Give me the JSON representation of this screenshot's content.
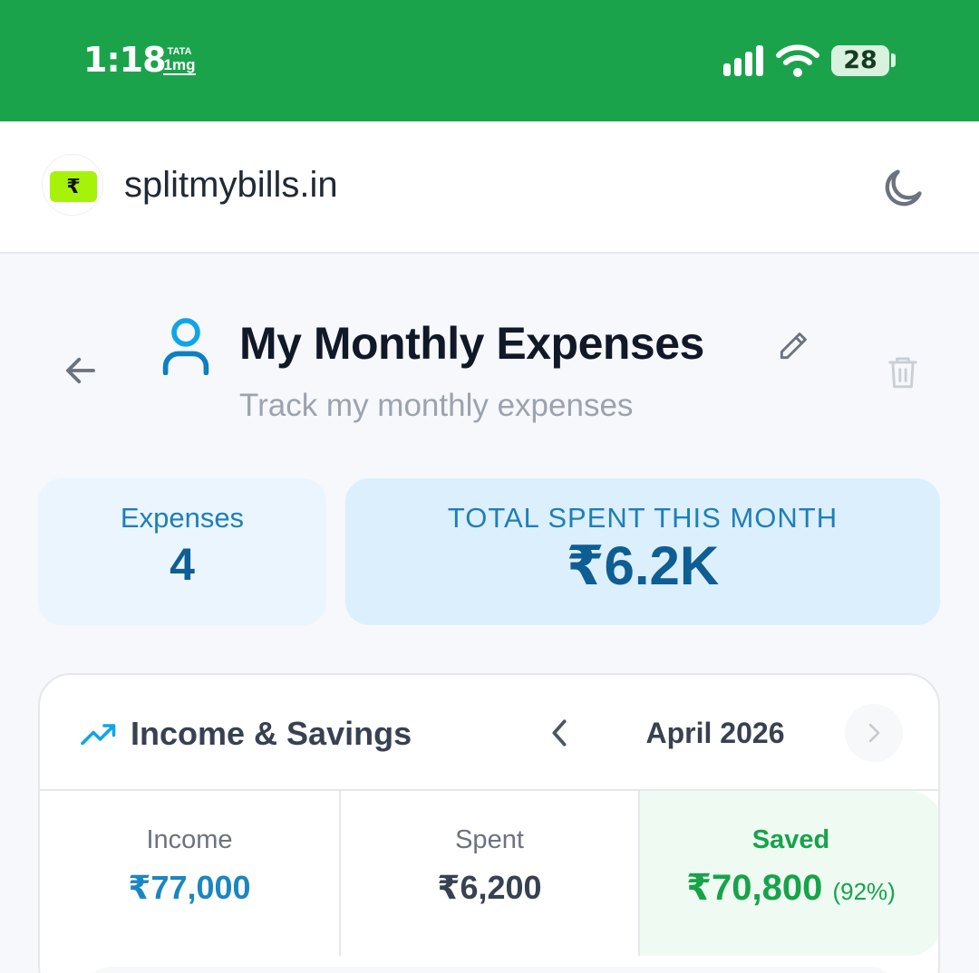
{
  "status_bar": {
    "time": "1:18",
    "notification": {
      "line1": "TATA",
      "line2": "1mg"
    },
    "battery": "28",
    "colors": {
      "background": "#1ba34c"
    }
  },
  "header": {
    "logo_symbol": "₹",
    "site_name": "splitmybills.in",
    "theme_toggle_icon": "moon-icon"
  },
  "page": {
    "title": "My Monthly Expenses",
    "subtitle": "Track my monthly expenses",
    "icons": [
      "back-arrow-icon",
      "user-icon",
      "pencil-icon",
      "trash-icon"
    ]
  },
  "stats": {
    "expenses_label": "Expenses",
    "expenses_count": "4",
    "total_label": "TOTAL SPENT THIS MONTH",
    "total_value": "₹6.2K"
  },
  "income": {
    "title": "Income & Savings",
    "month": "April 2026",
    "income_label": "Income",
    "income_value": "₹77,000",
    "spent_label": "Spent",
    "spent_value": "₹6,200",
    "saved_label": "Saved",
    "saved_value": "₹70,800",
    "saved_percent": "(92%)"
  },
  "colors": {
    "accent": "#0e5e93",
    "income": "#1a86c2",
    "saved": "#16a34a"
  }
}
